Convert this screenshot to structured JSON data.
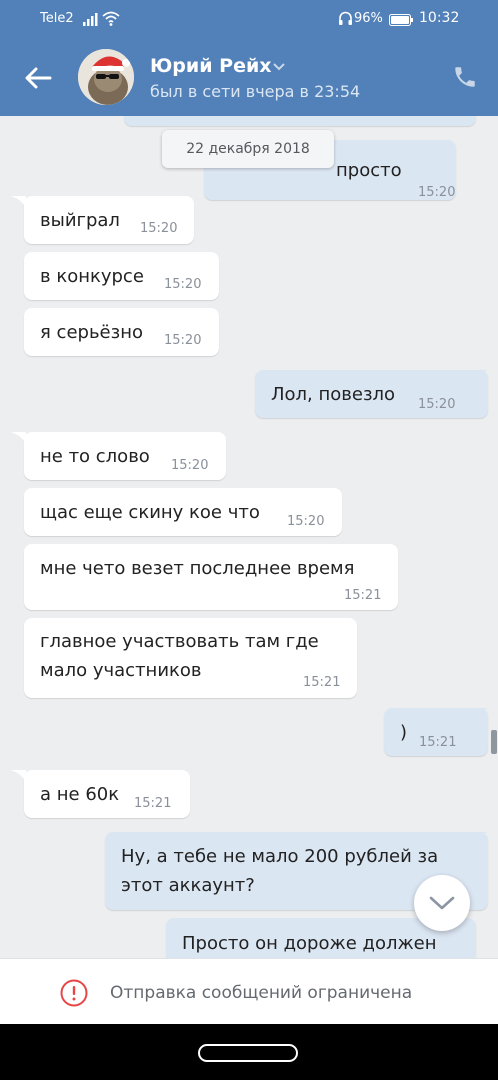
{
  "status_bar": {
    "carrier": "Tele2",
    "battery": "96%",
    "time": "10:32"
  },
  "header": {
    "name": "Юрий Рейх",
    "status": "был в сети вчера в 23:54"
  },
  "chat": {
    "date_separator": "22 декабря 2018",
    "messages": [
      {
        "dir": "out",
        "text": "просто",
        "time": "15:20"
      },
      {
        "dir": "in",
        "text": "выйграл",
        "time": "15:20"
      },
      {
        "dir": "in",
        "text": "в конкурсе",
        "time": "15:20"
      },
      {
        "dir": "in",
        "text": "я серьёзно",
        "time": "15:20"
      },
      {
        "dir": "out",
        "text": "Лол, повезло",
        "time": "15:20"
      },
      {
        "dir": "in",
        "text": "не то слово",
        "time": "15:20"
      },
      {
        "dir": "in",
        "text": "щас еще скину кое что",
        "time": "15:20"
      },
      {
        "dir": "in",
        "text": "мне чето везет последнее время",
        "time": "15:21"
      },
      {
        "dir": "in",
        "text": "главное участвовать там где\nмало участников",
        "time": "15:21"
      },
      {
        "dir": "out",
        "text": ")",
        "time": "15:21"
      },
      {
        "dir": "in",
        "text": "а не 60к",
        "time": "15:21"
      },
      {
        "dir": "out",
        "text": "Ну, а тебе не мало 200 рублей за\nэтот аккаунт?",
        "time": ""
      },
      {
        "dir": "out",
        "text": "Просто он дороже должен",
        "time": ""
      }
    ]
  },
  "restriction": {
    "text": "Отправка сообщений ограничена"
  },
  "icons": {
    "back": "arrow-left-icon",
    "call": "phone-icon",
    "scroll": "chevron-down-icon",
    "warning": "exclamation-circle-icon"
  },
  "colors": {
    "header": "#5181b8",
    "outgoing_bubble": "#dbe6f3",
    "incoming_bubble": "#ffffff",
    "background": "#edeef0",
    "warning": "#e64646"
  }
}
